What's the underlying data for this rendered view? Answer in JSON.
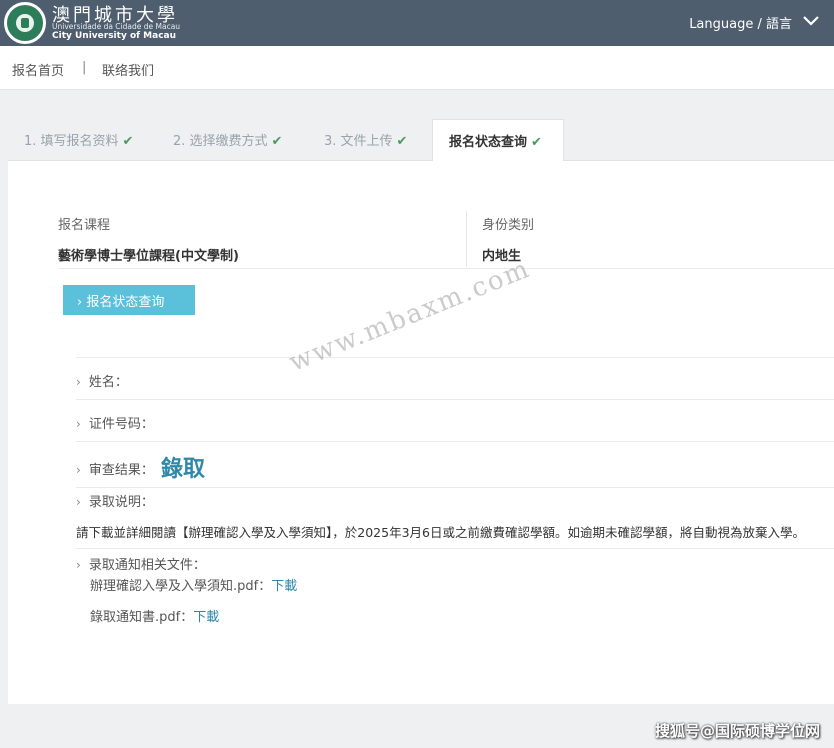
{
  "header": {
    "brand_cn": "澳門城市大學",
    "brand_pt": "Universidade da Cidade de Macau",
    "brand_en": "City University of Macau",
    "language_label": "Language / 語言"
  },
  "subnav": {
    "home": "报名首页",
    "separator": "|",
    "contact": "联络我们"
  },
  "steps": [
    {
      "label": "1. 填写报名资料"
    },
    {
      "label": "2. 选择缴费方式"
    },
    {
      "label": "3. 文件上传"
    },
    {
      "label": "报名状态查询"
    }
  ],
  "check_mark": "✔",
  "application": {
    "course_label": "报名课程",
    "course_value": "藝術學博士學位課程(中文學制)",
    "identity_label": "身份类别",
    "identity_value": "内地生"
  },
  "query_button": "› 报名状态查询",
  "status": {
    "name_label": "姓名：",
    "id_label": "证件号码：",
    "result_label": "审查结果：",
    "result_value": "錄取",
    "explain_label": "录取说明：",
    "notice_text": "請下載並詳細閱讀【辦理確認入學及入學須知】，於2025年3月6日或之前繳費確認學額。如逾期未確認學額，將自動視為放棄入學。",
    "docs_label": "录取通知相关文件：",
    "files": [
      {
        "name": "辦理確認入學及入學須知.pdf：",
        "link": "下載"
      },
      {
        "name": "錄取通知書.pdf：",
        "link": "下載"
      }
    ]
  },
  "watermark": "www.mbaxm.com",
  "footer_mark": "搜狐号@国际硕博学位网",
  "colors": {
    "header_bg": "#4f5e6e",
    "accent": "#5bc0d9",
    "result": "#2f88a8",
    "check": "#4b9a5e"
  }
}
